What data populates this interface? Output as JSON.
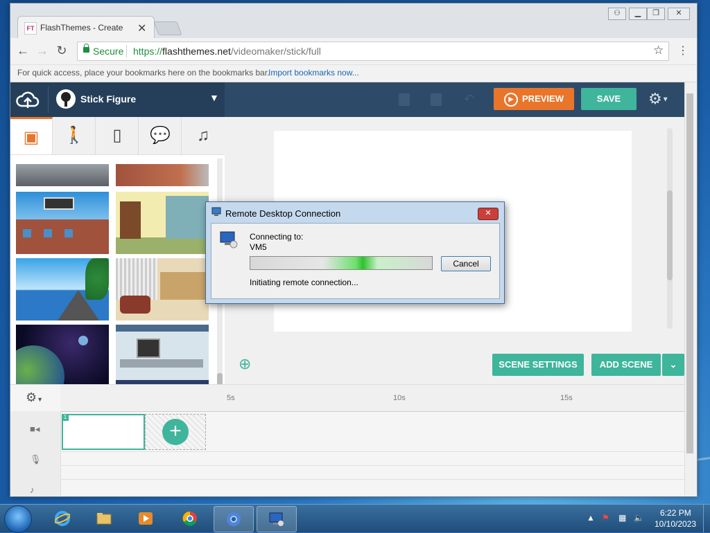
{
  "browser": {
    "tab_title": "FlashThemes - Create",
    "tab_close": "✕",
    "address": {
      "secure_label": "Secure",
      "url_scheme": "https://",
      "url_domain": "flashthemes.net",
      "url_path": "/videomaker/stick/full"
    },
    "bookmarks_bar": {
      "text": "For quick access, place your bookmarks here on the bookmarks bar.",
      "link": "Import bookmarks now..."
    }
  },
  "app": {
    "theme_name": "Stick Figure",
    "preview_label": "PREVIEW",
    "save_label": "SAVE",
    "scene_settings_label": "SCENE SETTINGS",
    "add_scene_label": "ADD SCENE",
    "timeline_ticks": [
      "5s",
      "10s",
      "15s"
    ],
    "scene_number": "1"
  },
  "dialog": {
    "title": "Remote Desktop Connection",
    "connecting_label": "Connecting to:",
    "target": "VM5",
    "cancel_label": "Cancel",
    "status": "Initiating remote connection..."
  },
  "taskbar": {
    "time": "6:22 PM",
    "date": "10/10/2023"
  },
  "colors": {
    "app_header": "#2d4b68",
    "accent_orange": "#e9752b",
    "accent_teal": "#3fb59b"
  }
}
